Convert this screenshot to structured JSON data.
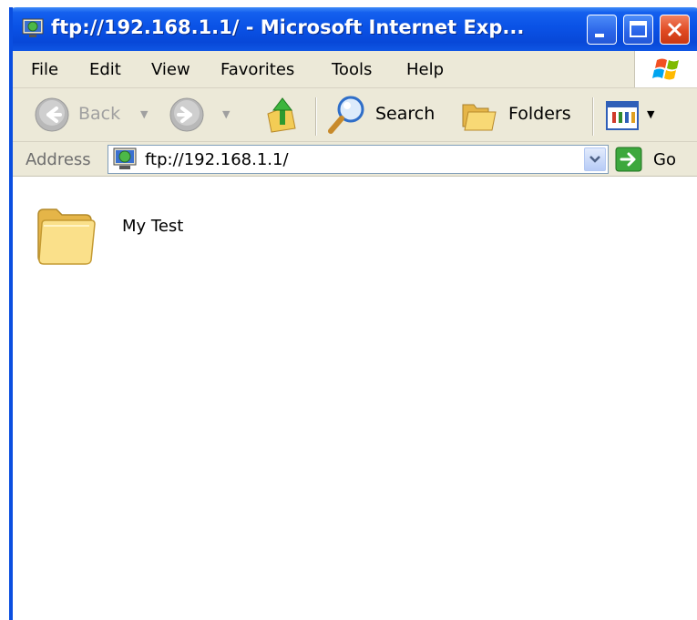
{
  "window": {
    "title": "ftp://192.168.1.1/ - Microsoft Internet Exp...",
    "title_icon": "ftp-globe-icon",
    "controls": {
      "minimize": "minimize-icon",
      "maximize": "maximize-icon",
      "close": "close-icon"
    },
    "accent": "#0A52E6",
    "close_color": "#E04A22"
  },
  "menubar": {
    "items": [
      "File",
      "Edit",
      "View",
      "Favorites",
      "Tools",
      "Help"
    ],
    "logo": "windows-flag-icon"
  },
  "toolbar": {
    "back_label": "Back",
    "search_label": "Search",
    "folders_label": "Folders",
    "icons": [
      "back-arrow-icon",
      "forward-arrow-icon",
      "up-folder-icon",
      "search-icon",
      "folders-icon",
      "views-icon"
    ]
  },
  "addressbar": {
    "label": "Address",
    "value": "ftp://192.168.1.1/",
    "go_label": "Go"
  },
  "content": {
    "items": [
      {
        "name": "My Test",
        "icon": "folder-icon"
      }
    ]
  }
}
